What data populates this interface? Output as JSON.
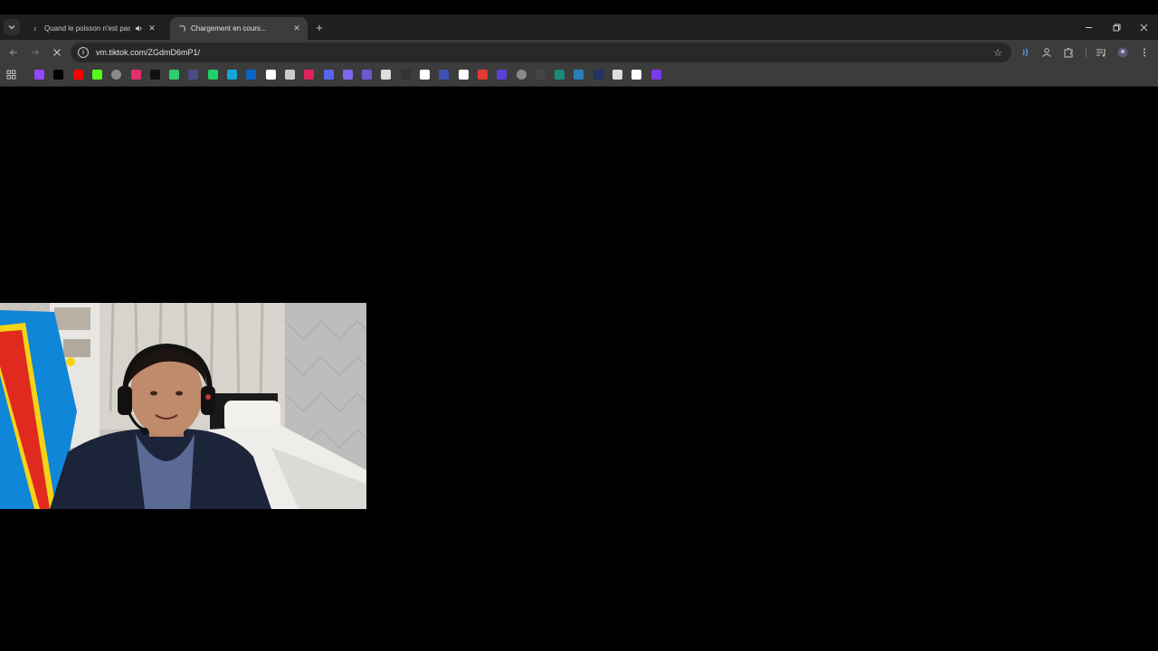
{
  "browser": {
    "tabs": [
      {
        "title": "Quand le poisson n'est pas",
        "state": "inactive",
        "favicon": "tiktok-icon",
        "audio": true
      },
      {
        "title": "Chargement en cours...",
        "state": "active-loading",
        "favicon": "loading-spinner"
      }
    ],
    "address_bar": {
      "url": "vm.tiktok.com/ZGdmD6mP1/"
    },
    "bookmarks": [
      {
        "icon": "twitch-icon",
        "color": "#9146ff"
      },
      {
        "icon": "x-icon",
        "color": "#000000"
      },
      {
        "icon": "youtube-icon",
        "color": "#ff0000"
      },
      {
        "icon": "kick-icon",
        "color": "#53fc18"
      },
      {
        "icon": "globe-icon",
        "color": "#8a8a8a"
      },
      {
        "icon": "instagram-icon",
        "color": "#e1306c"
      },
      {
        "icon": "tiktok-icon",
        "color": "#111111"
      },
      {
        "icon": "app-icon",
        "color": "#2ecc71"
      },
      {
        "icon": "bookmark-icon",
        "color": "#4a4a8a"
      },
      {
        "icon": "app-icon",
        "color": "#1fd16b"
      },
      {
        "icon": "app-icon",
        "color": "#12a6d8"
      },
      {
        "icon": "linkedin-icon",
        "color": "#0a66c2"
      },
      {
        "icon": "info-icon",
        "color": "#ffffff"
      },
      {
        "icon": "openai-icon",
        "color": "#cccccc"
      },
      {
        "icon": "app-icon",
        "color": "#e0245e"
      },
      {
        "icon": "app-icon",
        "color": "#5865f2"
      },
      {
        "icon": "app-icon",
        "color": "#7b68ee"
      },
      {
        "icon": "app-icon",
        "color": "#6a5acd"
      },
      {
        "icon": "app-icon",
        "color": "#dddddd"
      },
      {
        "icon": "app-icon",
        "color": "#333333"
      },
      {
        "icon": "app-icon",
        "color": "#ffffff"
      },
      {
        "icon": "app-icon",
        "color": "#3f51b5"
      },
      {
        "icon": "app-icon",
        "color": "#ffffff"
      },
      {
        "icon": "app-icon",
        "color": "#e53935"
      },
      {
        "icon": "app-icon",
        "color": "#5b3fd6"
      },
      {
        "icon": "globe-icon",
        "color": "#8a8a8a"
      },
      {
        "icon": "app-icon",
        "color": "#444444"
      },
      {
        "icon": "app-icon",
        "color": "#1a8a7a"
      },
      {
        "icon": "app-icon",
        "color": "#2980b9"
      },
      {
        "icon": "app-icon",
        "color": "#223366"
      },
      {
        "icon": "app-icon",
        "color": "#dddddd"
      },
      {
        "icon": "app-icon",
        "color": "#ffffff"
      },
      {
        "icon": "app-icon",
        "color": "#7c3aed"
      }
    ]
  },
  "page": {
    "state": "loading"
  },
  "overlay": {
    "type": "webcam",
    "colors": {
      "flag_blue": "#0f86d8",
      "flag_red": "#e02a1f",
      "flag_yellow": "#f5d316"
    }
  }
}
